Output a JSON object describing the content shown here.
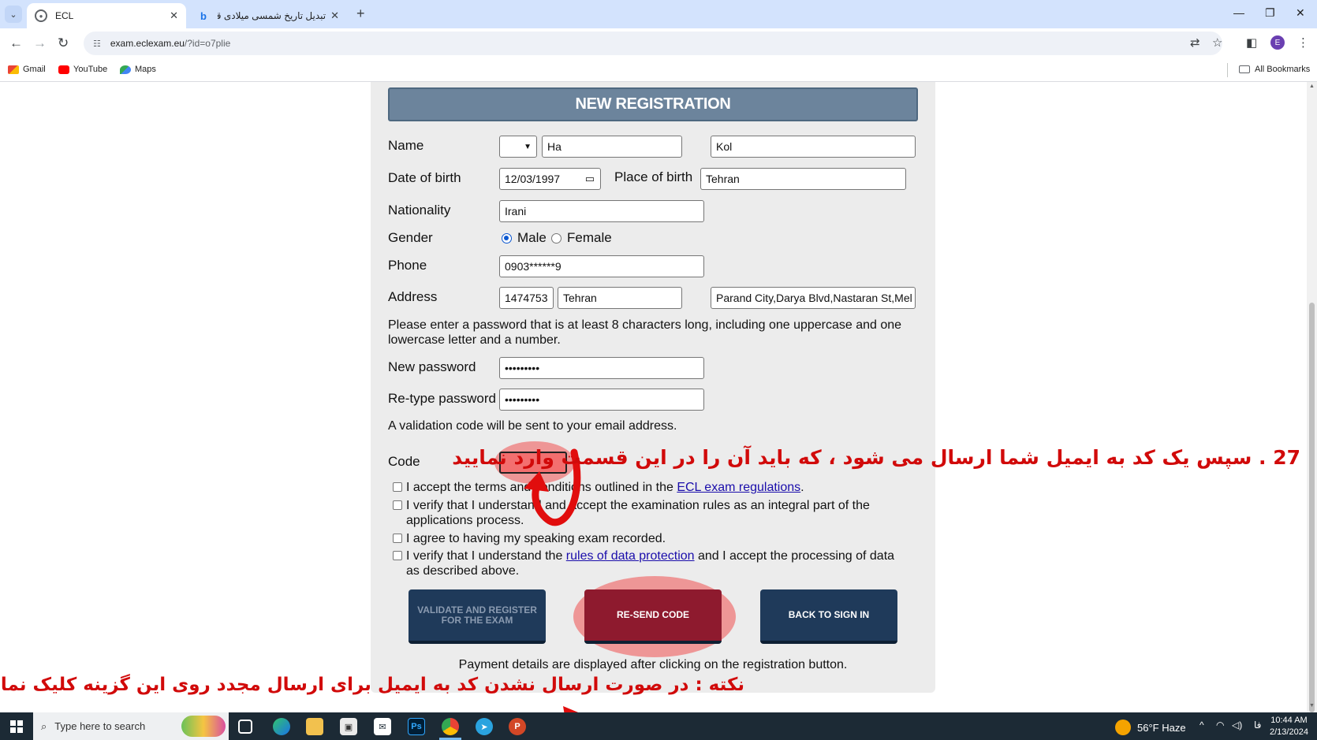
{
  "browser": {
    "tabs": [
      {
        "title": "ECL",
        "active": true
      },
      {
        "title": "تبدیل تاریخ شمسی میلادی قمری",
        "active": false
      }
    ],
    "url_host": "exam.eclexam.eu",
    "url_path": "/?id=o7plie",
    "bookmarks": [
      "Gmail",
      "YouTube",
      "Maps"
    ],
    "all_bookmarks": "All Bookmarks",
    "profile_initial": "E"
  },
  "form": {
    "title": "NEW REGISTRATION",
    "name_label": "Name",
    "first_name": "Ha",
    "last_name": "Kol",
    "dob_label": "Date of birth",
    "dob_value": "12/03/1997",
    "pob_label": "Place of birth",
    "pob_value": "Tehran",
    "nationality_label": "Nationality",
    "nationality_value": "Irani",
    "gender_label": "Gender",
    "gender_male": "Male",
    "gender_female": "Female",
    "phone_label": "Phone",
    "phone_value": "0903******9",
    "address_label": "Address",
    "address_zip": "1474753",
    "address_city": "Tehran",
    "address_street": "Parand City,Darya Blvd,Nastaran St,Mel",
    "password_hint": "Please enter a password that is at least 8 characters long, including one uppercase and one lowercase letter and a number.",
    "new_password_label": "New password",
    "new_password_value": "•••••••••",
    "retype_password_label": "Re-type password",
    "retype_password_value": "•••••••••",
    "validation_note": "A validation code will be sent to your email address.",
    "code_label": "Code",
    "agreements": {
      "a1_pre": "I accept the terms and conditions outlined in the ",
      "a1_link": "ECL exam regulations",
      "a1_post": ".",
      "a2": "I verify that I understand and accept the examination rules as an integral part of the applications process.",
      "a3": "I agree to having my speaking exam recorded.",
      "a4_pre": "I verify that I understand the ",
      "a4_link": "rules of data protection",
      "a4_post": " and I accept the processing of data as described above."
    },
    "buttons": {
      "validate": "VALIDATE AND REGISTER FOR THE EXAM",
      "resend": "RE-SEND CODE",
      "back": "BACK TO SIGN IN"
    },
    "payment_note": "Payment details are displayed after clicking on the registration button."
  },
  "annotations": {
    "step": "27 . سپس یک کد به ایمیل شما ارسال می شود ، که باید آن را در این قسمت وارد نمایید",
    "note": "نکته : در صورت ارسال نشدن کد به ایمیل برای ارسال مجدد روی این گزینه کلیک نمایید",
    "color": "#d10a0a"
  },
  "taskbar": {
    "search_placeholder": "Type here to search",
    "weather_temp": "56°F",
    "weather_cond": "Haze",
    "lang": "فا",
    "time": "10:44 AM",
    "date": "2/13/2024"
  }
}
